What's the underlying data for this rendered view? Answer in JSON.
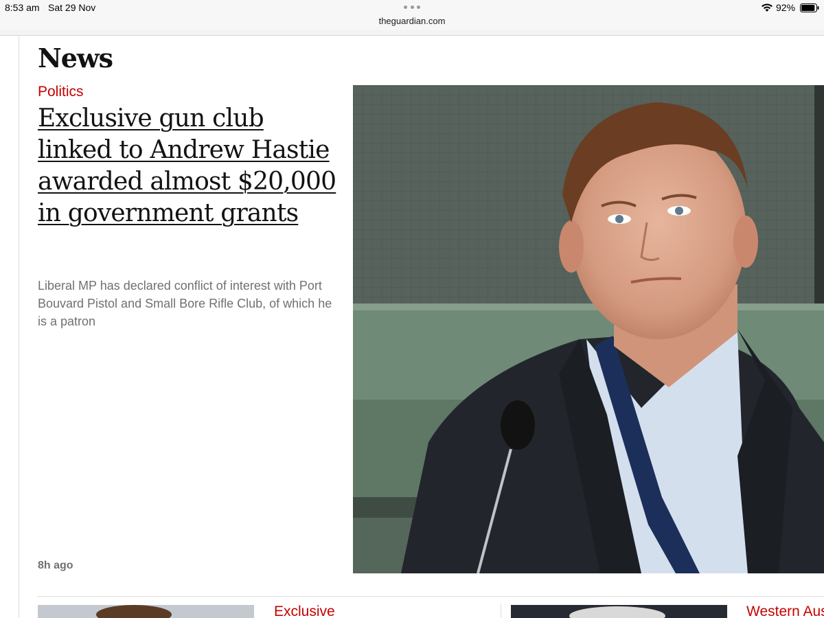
{
  "status_bar": {
    "time": "8:53 am",
    "date": "Sat 29 Nov",
    "battery_percent": "92%",
    "battery_level": 0.92,
    "wifi_icon": "wifi-icon",
    "battery_icon": "battery-icon"
  },
  "browser": {
    "url": "theguardian.com"
  },
  "page": {
    "section_title": "News",
    "colors": {
      "kicker": "#c70000",
      "headline": "#121212",
      "standfirst": "#707070"
    }
  },
  "lead_story": {
    "kicker": "Politics",
    "headline": "Exclusive gun club linked to Andrew Hastie awarded almost $20,000 in government grants",
    "standfirst": "Liberal MP has declared conflict of interest with Port Bouvard Pistol and Small Bore Rifle Club, of which he is a patron",
    "timestamp": "8h ago"
  },
  "secondary_stories": [
    {
      "kicker": "Exclusive"
    },
    {
      "kicker": "Western Aus"
    }
  ]
}
